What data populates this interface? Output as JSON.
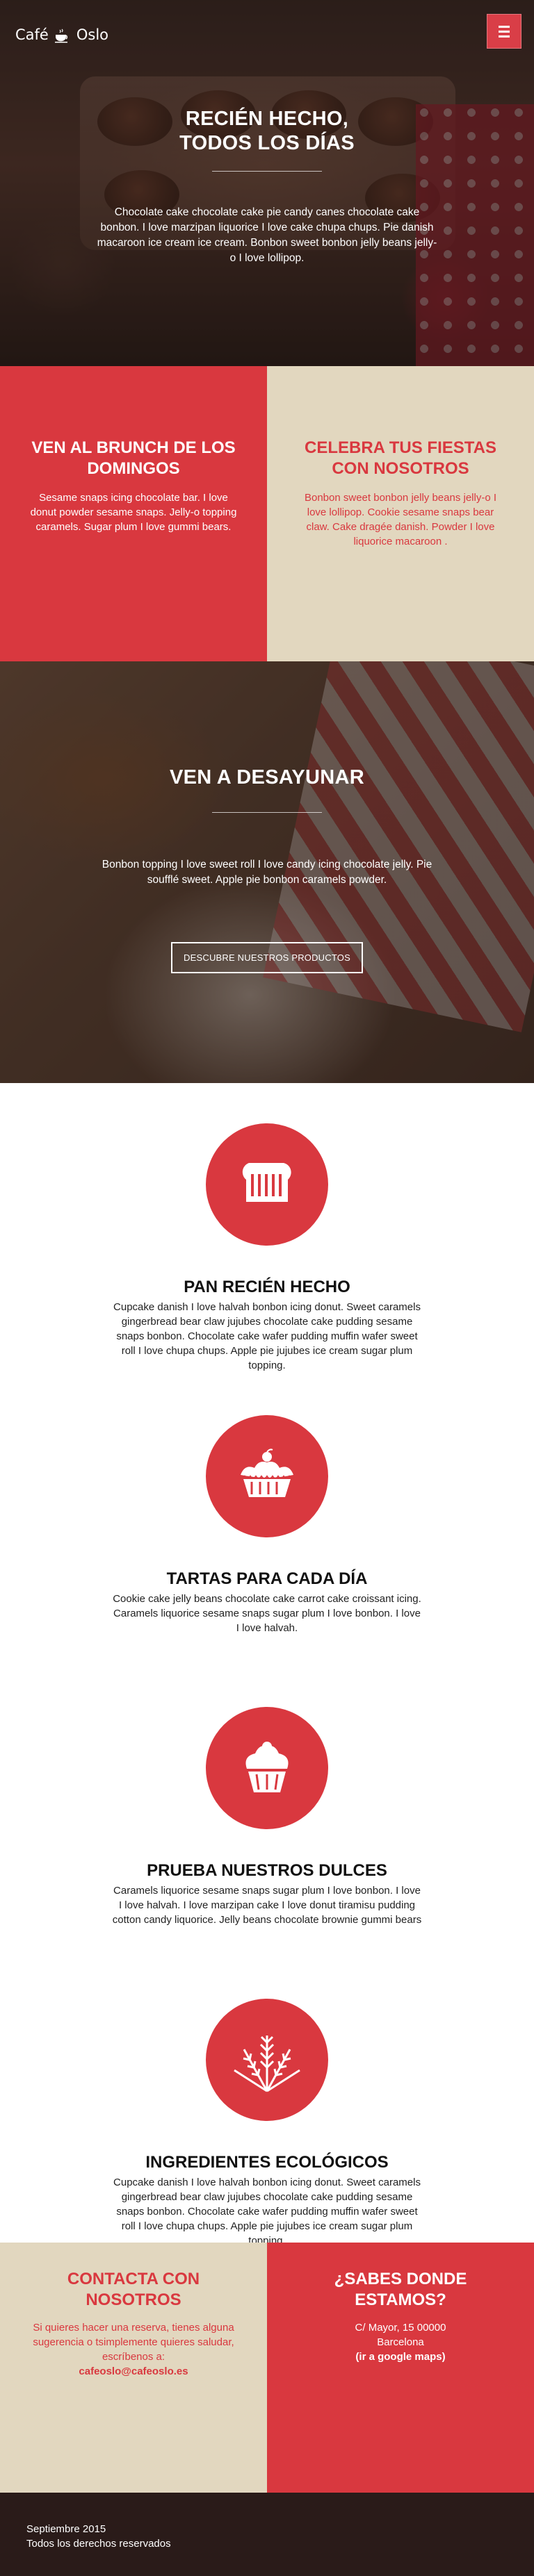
{
  "header": {
    "logo_left": "Café",
    "logo_right": "Oslo",
    "logo_icon": "coffee-cup-icon",
    "menu_icon": "hamburger-menu-icon"
  },
  "hero": {
    "title_line1": "RECIÉN HECHO,",
    "title_line2": "TODOS LOS DÍAS",
    "text": "Chocolate cake chocolate cake pie candy canes chocolate cake bonbon. I love marzipan liquorice I love cake chupa chups. Pie danish macaroon ice cream ice cream. Bonbon sweet bonbon jelly beans jelly-o I love lollipop."
  },
  "promo": {
    "brunch": {
      "title": "VEN AL BRUNCH DE LOS DOMINGOS",
      "text": "Sesame snaps icing chocolate bar. I love donut powder sesame snaps. Jelly-o topping caramels. Sugar plum I love gummi bears."
    },
    "parties": {
      "title": "CELEBRA TUS FIESTAS CON NOSOTROS",
      "text": "Bonbon sweet bonbon jelly beans jelly-o I love lollipop. Cookie sesame snaps bear claw. Cake dragée danish. Powder I love liquorice macaroon ."
    }
  },
  "breakfast": {
    "title": "VEN A DESAYUNAR",
    "text": "Bonbon topping I love sweet roll I love candy icing chocolate jelly. Pie soufflé sweet. Apple pie bonbon caramels powder.",
    "button": "DESCUBRE NUESTROS PRODUCTOS"
  },
  "features": [
    {
      "icon": "bread-icon",
      "title": "PAN RECIÉN HECHO",
      "text": "Cupcake danish I love halvah bonbon icing donut. Sweet caramels gingerbread bear claw jujubes chocolate cake pudding sesame snaps bonbon. Chocolate cake wafer pudding muffin wafer sweet roll I love chupa chups. Apple pie jujubes ice cream sugar plum topping."
    },
    {
      "icon": "pie-icon",
      "title": "TARTAS PARA CADA DÍA",
      "text": "Cookie cake jelly beans chocolate cake carrot cake croissant icing. Caramels liquorice sesame snaps sugar plum I love bonbon. I love I love halvah."
    },
    {
      "icon": "cupcake-icon",
      "title": "PRUEBA NUESTROS DULCES",
      "text": "Caramels liquorice sesame snaps sugar plum I love bonbon. I love I love halvah. I love marzipan cake I love donut tiramisu pudding cotton candy liquorice. Jelly beans chocolate brownie gummi bears"
    },
    {
      "icon": "wheat-icon",
      "title": "INGREDIENTES ECOLÓGICOS",
      "text": "Cupcake danish I love halvah bonbon icing donut. Sweet caramels gingerbread bear claw jujubes chocolate cake pudding sesame snaps bonbon. Chocolate cake wafer pudding muffin wafer sweet roll I love chupa chups. Apple pie jujubes ice cream sugar plum topping."
    }
  ],
  "contact": {
    "title": "CONTACTA CON NOSOTROS",
    "text": "Si quieres hacer una reserva, tienes alguna sugerencia o tsimplemente quieres saludar, escríbenos a:",
    "email": "cafeoslo@cafeoslo.es"
  },
  "location": {
    "title": "¿SABES DONDE ESTAMOS?",
    "address": "C/ Mayor, 15 00000",
    "city": "Barcelona",
    "maps_link": "(ir a google maps)"
  },
  "footer": {
    "date": "Septiembre 2015",
    "rights": "Todos los derechos reservados"
  },
  "colors": {
    "accent": "#d9383f",
    "beige": "#e2d7bf",
    "footer_bg": "#2a1b19"
  }
}
